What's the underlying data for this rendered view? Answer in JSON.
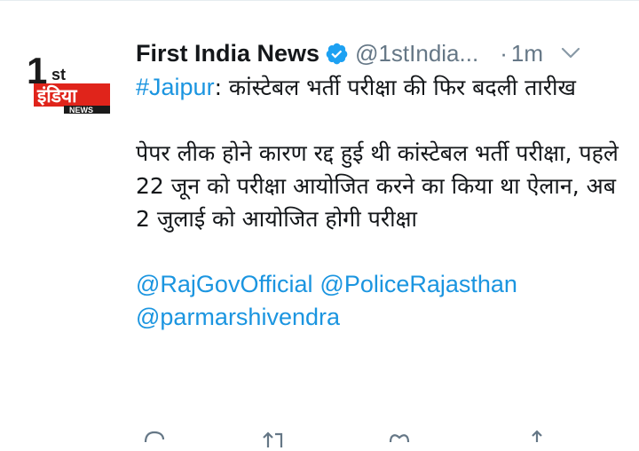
{
  "tweet": {
    "author_name": "First India News",
    "author_handle": "@1stIndia...",
    "separator": "·",
    "time": "1m",
    "avatar": {
      "logo_prefix": "1",
      "logo_suffix": "st",
      "logo_main": "इंडिया",
      "logo_sub": "NEWS"
    },
    "hashtag": "#Jaipur",
    "line1_rest": ": कांस्टेबल भर्ती परीक्षा की फिर बदली तारीख",
    "paragraph2": "पेपर लीक होने कारण रद्द हुई थी कांस्टेबल भर्ती परीक्षा, पहले 22 जून को परीक्षा आयोजित करने का किया था ऐलान, अब 2 जुलाई को आयोजित होगी परीक्षा",
    "mention1": "@RajGovOfficial",
    "mention2": "@PoliceRajasthan",
    "mention3": "@parmarshivendra"
  },
  "icons": {
    "verified": "verified-badge-icon",
    "menu": "chevron-down-icon",
    "reply": "reply-icon",
    "retweet": "retweet-icon",
    "like": "heart-icon",
    "share": "share-icon"
  },
  "colors": {
    "text": "#14171a",
    "muted": "#657786",
    "link": "#1b95e0",
    "verified": "#1da1f2",
    "logo_red": "#e0241b"
  }
}
